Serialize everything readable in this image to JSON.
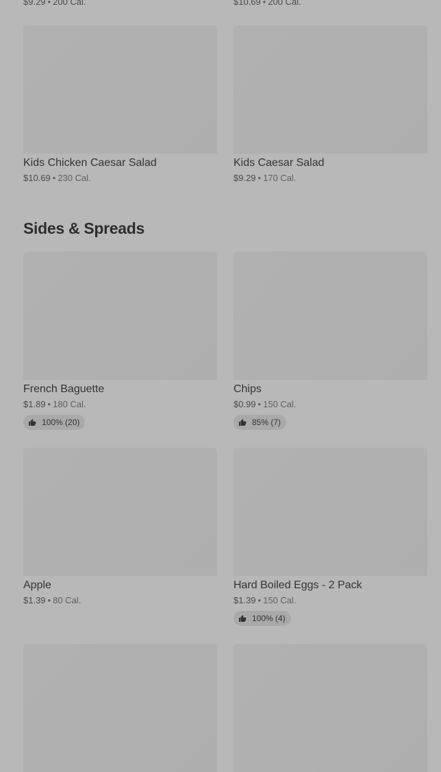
{
  "top_partial": [
    {
      "price": "$9.29",
      "calories": "200 Cal."
    },
    {
      "price": "$10.69",
      "calories": "200 Cal."
    }
  ],
  "kids_items": [
    {
      "name": "Kids Chicken Caesar Salad",
      "price": "$10.69",
      "calories": "230 Cal."
    },
    {
      "name": "Kids Caesar Salad",
      "price": "$9.29",
      "calories": "170 Cal."
    }
  ],
  "sides_section": {
    "title": "Sides & Spreads",
    "items": [
      {
        "name": "French Baguette",
        "price": "$1.89",
        "calories": "180 Cal.",
        "rating": "100% (20)"
      },
      {
        "name": "Chips",
        "price": "$0.99",
        "calories": "150 Cal.",
        "rating": "85% (7)"
      },
      {
        "name": "Apple",
        "price": "$1.39",
        "calories": "80 Cal."
      },
      {
        "name": "Hard Boiled Eggs - 2 Pack",
        "price": "$1.39",
        "calories": "150 Cal.",
        "rating": "100% (4)"
      }
    ]
  },
  "separator": "•",
  "icons": {
    "rating": "thumbs-up-icon"
  },
  "colors": {
    "overlay": "#b8b8b8",
    "placeholder": "#b0b0b0",
    "rating_pill": "#a9a9a9"
  }
}
